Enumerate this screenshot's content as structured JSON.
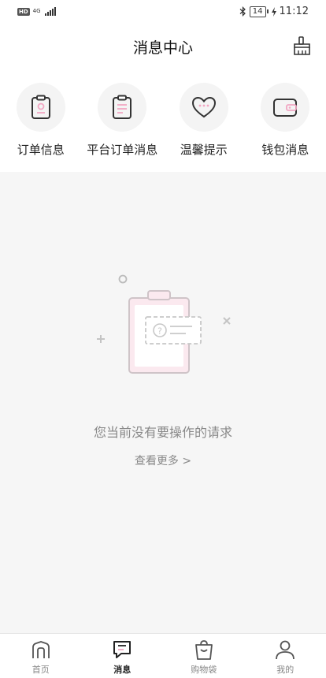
{
  "status_bar": {
    "hd_badge": "HD",
    "signal_label": "4G",
    "battery": "14",
    "time": "11:12"
  },
  "header": {
    "title": "消息中心",
    "clear_icon": "broom-icon"
  },
  "quick_actions": [
    {
      "label": "订单信息",
      "icon": "clipboard-icon"
    },
    {
      "label": "平台订单消息",
      "icon": "clipboard-list-icon"
    },
    {
      "label": "温馨提示",
      "icon": "heart-chat-icon"
    },
    {
      "label": "钱包消息",
      "icon": "wallet-icon"
    }
  ],
  "empty_state": {
    "message": "您当前没有要操作的请求",
    "more_link": "查看更多 >"
  },
  "tabbar": [
    {
      "label": "首页",
      "icon": "home-icon",
      "active": false
    },
    {
      "label": "消息",
      "icon": "message-icon",
      "active": true
    },
    {
      "label": "购物袋",
      "icon": "shopping-bag-icon",
      "active": false
    },
    {
      "label": "我的",
      "icon": "user-icon",
      "active": false
    }
  ],
  "colors": {
    "accent_pink": "#f2a7c3",
    "icon_stroke": "#333333",
    "content_bg": "#f6f6f6"
  }
}
